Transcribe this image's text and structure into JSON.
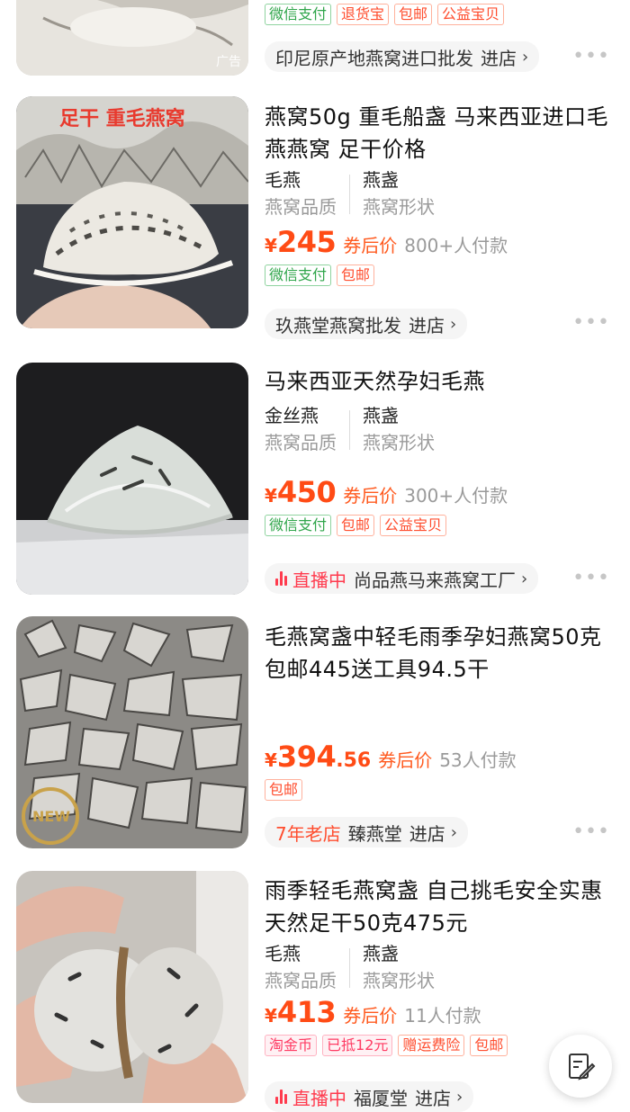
{
  "items": [
    {
      "ad_label": "广告",
      "tags": [
        {
          "text": "微信支付",
          "style": "green"
        },
        {
          "text": "退货宝",
          "style": "red"
        },
        {
          "text": "包邮",
          "style": "red"
        },
        {
          "text": "公益宝贝",
          "style": "red"
        }
      ],
      "store": {
        "name": "印尼原产地燕窝进口批发",
        "action": "进店"
      }
    },
    {
      "image_caption": "足干  重毛燕窝",
      "title": "燕窝50g 重毛船盏 马来西亚进口毛燕燕窝 足干价格",
      "attrs": [
        {
          "value": "毛燕",
          "key": "燕窝品质"
        },
        {
          "value": "燕盏",
          "key": "燕窝形状"
        }
      ],
      "price": {
        "currency": "¥",
        "int": "245",
        "dec": "",
        "after_label": "券后价",
        "sales": "800+人付款"
      },
      "tags": [
        {
          "text": "微信支付",
          "style": "green"
        },
        {
          "text": "包邮",
          "style": "red"
        }
      ],
      "store": {
        "name": "玖燕堂燕窝批发",
        "action": "进店"
      }
    },
    {
      "title": "马来西亚天然孕妇毛燕",
      "attrs": [
        {
          "value": "金丝燕",
          "key": "燕窝品质"
        },
        {
          "value": "燕盏",
          "key": "燕窝形状"
        }
      ],
      "price": {
        "currency": "¥",
        "int": "450",
        "dec": "",
        "after_label": "券后价",
        "sales": "300+人付款"
      },
      "tags": [
        {
          "text": "微信支付",
          "style": "green"
        },
        {
          "text": "包邮",
          "style": "red"
        },
        {
          "text": "公益宝贝",
          "style": "red"
        }
      ],
      "store": {
        "live": "直播中",
        "name": "尚品燕马来燕窝工厂",
        "action": ""
      }
    },
    {
      "title": "毛燕窝盏中轻毛雨季孕妇燕窝50克包邮445送工具94.5干",
      "price": {
        "currency": "¥",
        "int": "394",
        "dec": ".56",
        "after_label": "券后价",
        "sales": "53人付款"
      },
      "tags": [
        {
          "text": "包邮",
          "style": "red"
        }
      ],
      "store": {
        "prefix": "7年老店",
        "name": "臻燕堂",
        "action": "进店"
      }
    },
    {
      "title": "雨季轻毛燕窝盏 自己挑毛安全实惠天然足干50克475元",
      "attrs": [
        {
          "value": "毛燕",
          "key": "燕窝品质"
        },
        {
          "value": "燕盏",
          "key": "燕窝形状"
        }
      ],
      "price": {
        "currency": "¥",
        "int": "413",
        "dec": "",
        "after_label": "券后价",
        "sales": "11人付款"
      },
      "tags": [
        {
          "text": "淘金币",
          "style": "pink"
        },
        {
          "text": "已抵12元",
          "style": "pink"
        },
        {
          "text": "赠运费险",
          "style": "red"
        },
        {
          "text": "包邮",
          "style": "red"
        }
      ],
      "store": {
        "live": "直播中",
        "name": "福厦堂",
        "action": "进店"
      }
    }
  ],
  "more_glyph": "•••",
  "fab_icon": "edit-note-icon",
  "colors": {
    "price": "#ff4b15",
    "green_tag": "#2fa54a",
    "red_tag": "#ff4d2e",
    "live": "#ff3b4e"
  }
}
